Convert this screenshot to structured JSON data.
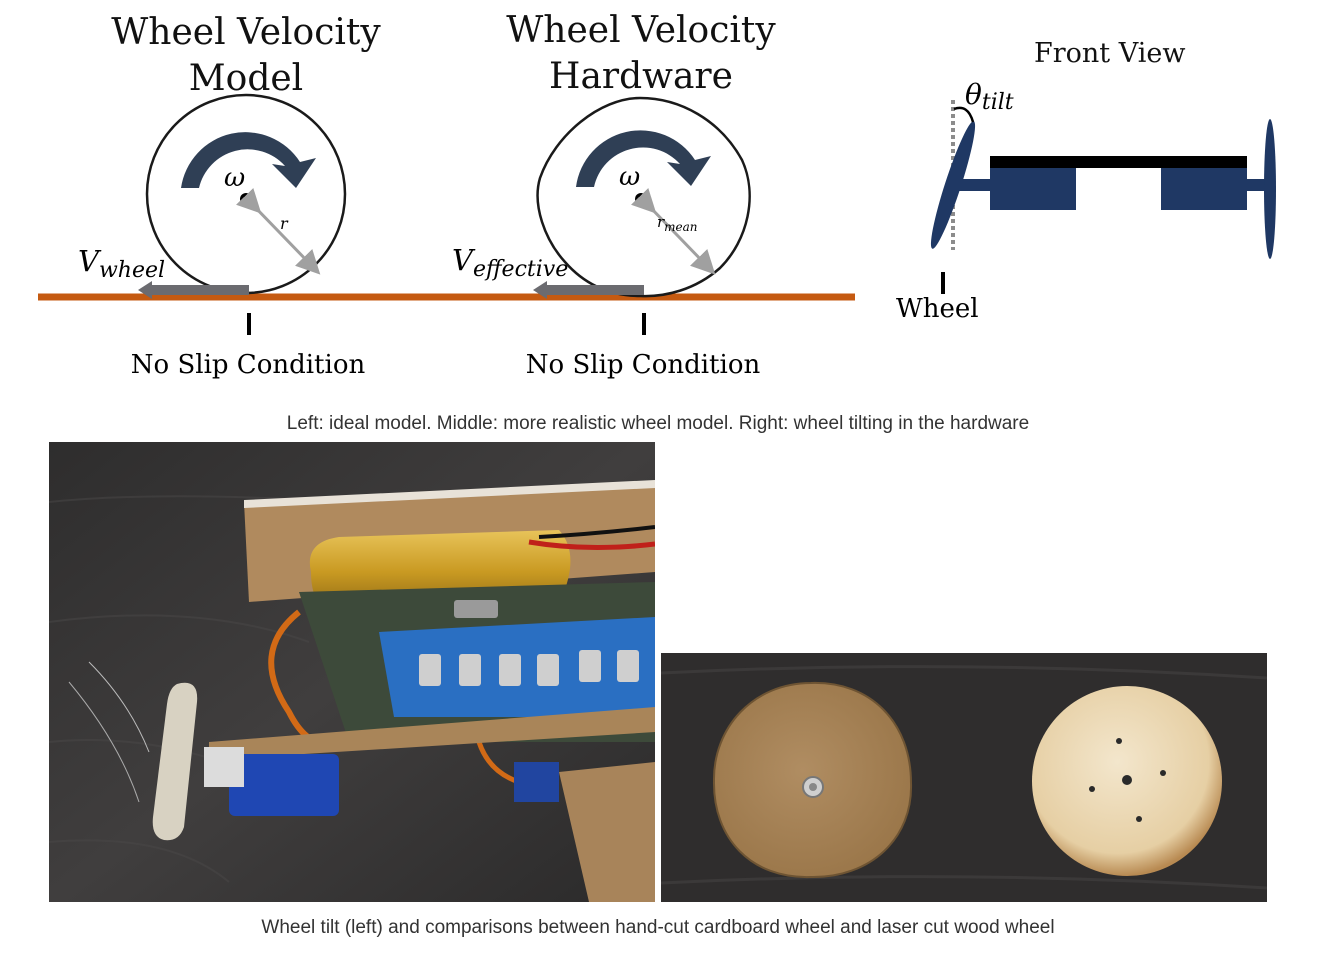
{
  "figure_top": {
    "model": {
      "title_line1": "Wheel Velocity",
      "title_line2": "Model",
      "omega": "ω",
      "radius": "r",
      "velocity_symbol": "V",
      "velocity_sub": "wheel",
      "condition": "No Slip Condition"
    },
    "hardware": {
      "title_line1": "Wheel Velocity",
      "title_line2": "Hardware",
      "omega": "ω",
      "radius_symbol": "r",
      "radius_sub": "mean",
      "velocity_symbol": "V",
      "velocity_sub": "effective",
      "condition": "No Slip Condition"
    },
    "front_view": {
      "title": "Front View",
      "angle_symbol": "θ",
      "angle_sub": "tilt",
      "wheel_label": "Wheel"
    },
    "caption": "Left: ideal model. Middle: more realistic wheel model. Right: wheel tilting in the hardware"
  },
  "figure_bottom": {
    "caption": "Wheel tilt (left) and comparisons between hand-cut cardboard wheel and laser cut wood wheel"
  },
  "colors": {
    "ground": "#c55a11",
    "arrow_dark": "#2f3f55",
    "velocity_bar": "#6b6b70",
    "radius_line": "#a0a0a0",
    "navy": "#1f3864",
    "black": "#000000",
    "photo_bg": "#3a3838"
  }
}
